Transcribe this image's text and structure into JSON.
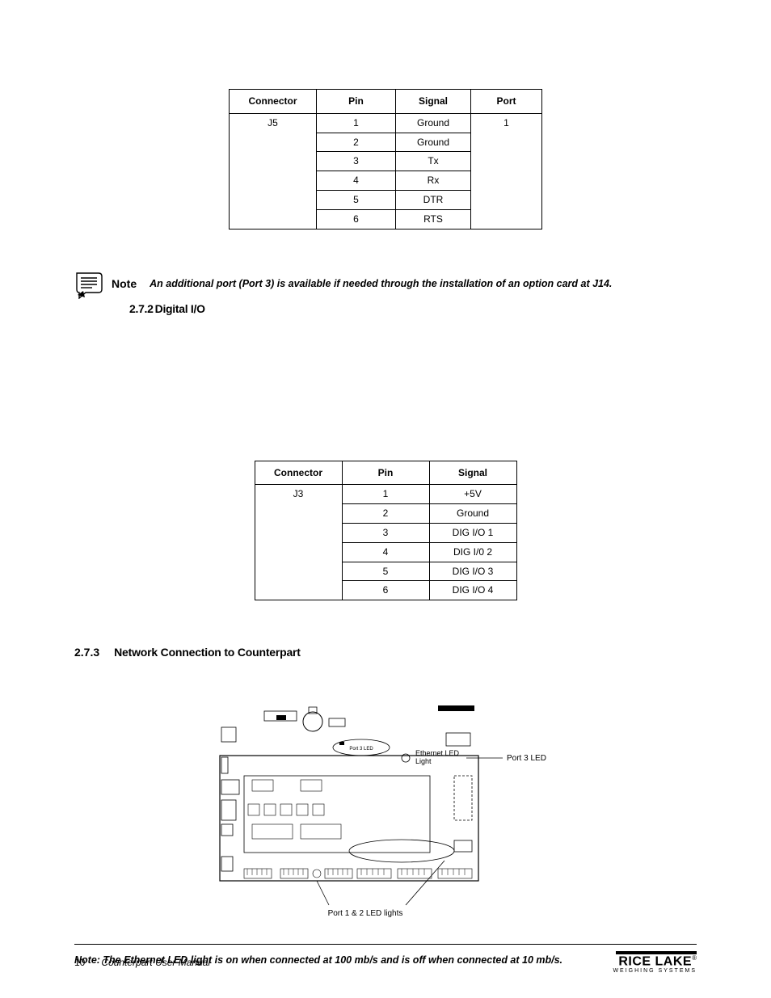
{
  "table1": {
    "headers": [
      "Connector",
      "Pin",
      "Signal",
      "Port"
    ],
    "connector": "J5",
    "port": "1",
    "rows": [
      {
        "pin": "1",
        "signal": "Ground"
      },
      {
        "pin": "2",
        "signal": "Ground"
      },
      {
        "pin": "3",
        "signal": "Tx"
      },
      {
        "pin": "4",
        "signal": "Rx"
      },
      {
        "pin": "5",
        "signal": "DTR"
      },
      {
        "pin": "6",
        "signal": "RTS"
      }
    ]
  },
  "note1": {
    "label": "Note",
    "text": "An additional port (Port 3) is available if needed through the installation of an option card at J14."
  },
  "section272": {
    "num": "2.7.2",
    "title": "Digital I/O"
  },
  "table2": {
    "headers": [
      "Connector",
      "Pin",
      "Signal"
    ],
    "connector": "J3",
    "rows": [
      {
        "pin": "1",
        "signal": "+5V"
      },
      {
        "pin": "2",
        "signal": "Ground"
      },
      {
        "pin": "3",
        "signal": "DIG I/O 1"
      },
      {
        "pin": "4",
        "signal": "DIG I/0 2"
      },
      {
        "pin": "5",
        "signal": "DIG I/O 3"
      },
      {
        "pin": "6",
        "signal": "DIG I/O 4"
      }
    ]
  },
  "section273": {
    "num": "2.7.3",
    "title": "Network Connection to Counterpart"
  },
  "figure": {
    "label_port3_led_internal": "Port 3 LED",
    "label_ethernet_led": "Ethernet LED Light",
    "label_port3_led_external": "Port 3 LED",
    "label_port12": "Port 1 & 2 LED lights"
  },
  "eth_note": "Note: The Ethernet LED light is on when connected at 100 mb/s and is off when connected at 10 mb/s.",
  "footer": {
    "page": "10",
    "title": "Counterpart User Manual",
    "logo_main": "RICE LAKE",
    "logo_sub": "WEIGHING SYSTEMS"
  }
}
